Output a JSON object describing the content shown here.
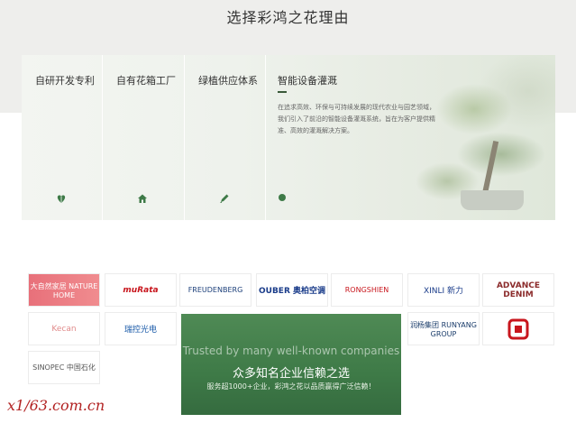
{
  "section_title": "选择彩鸿之花理由",
  "reasons": [
    {
      "label": "自研开发专利",
      "icon": "heart-leaf-icon"
    },
    {
      "label": "自有花箱工厂",
      "icon": "house-icon"
    },
    {
      "label": "绿植供应体系",
      "icon": "pencil-icon"
    },
    {
      "label": "智能设备灌溉",
      "icon": "dot-icon",
      "description": "在追求高效、环保与可持续发展的现代农业与园艺领域，我们引入了前沿的智能设备灌溉系统，旨在为客户提供精准、高效的灌溉解决方案。"
    }
  ],
  "logos": [
    {
      "name": "大自然家居 NATURE HOME"
    },
    {
      "name": "muRata"
    },
    {
      "name": "FREUDENBERG"
    },
    {
      "name": "OUBER 奥柏空调"
    },
    {
      "name": "RONGSHIEN"
    },
    {
      "name": "XINLI 新力"
    },
    {
      "name": "ADVANCE DENIM"
    },
    {
      "name": "Kecan"
    },
    {
      "name": "瑞控光电"
    },
    {
      "name": "润杨集团 RUNYANG GROUP"
    },
    {
      "name": "SINOPEC 中国石化"
    },
    {
      "name": "logo"
    }
  ],
  "trust": {
    "en": "Trusted by many well-known companies",
    "cn": "众多知名企业信赖之选",
    "sub": "服务超1000+企业，彩鸿之花以品质赢得广泛信赖！"
  },
  "watermark": "x1/63.com.cn",
  "colors": {
    "accent": "#3e7a47",
    "heading": "#333333"
  }
}
